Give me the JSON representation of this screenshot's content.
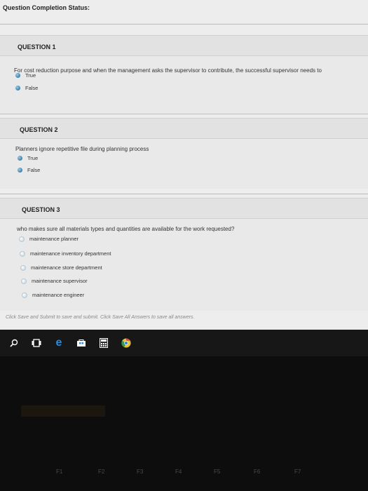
{
  "page": {
    "completion_status_label": "Question Completion Status:"
  },
  "questions": [
    {
      "title": "QUESTION 1",
      "text": "For cost reduction purpose and when the management asks the supervisor to contribute, the successful supervisor needs to",
      "options": [
        "True",
        "False"
      ]
    },
    {
      "title": "QUESTION 2",
      "text": "Planners ignore repetitive file during planning process",
      "options": [
        "True",
        "False"
      ]
    },
    {
      "title": "QUESTION 3",
      "text": "who makes sure all materials types and quantities are available for the work requested?",
      "options": [
        "maintenance planner",
        "maintenance inventory department",
        "maintenance store department",
        "maintenance supervisor",
        "maintenance engineer"
      ]
    }
  ],
  "footer_note": "Click Save and Submit to save and submit. Click Save All Answers to save all answers.",
  "taskbar": {
    "icons": [
      "search-icon",
      "task-view-icon",
      "edge-icon",
      "store-icon",
      "calculator-icon",
      "chrome-icon"
    ]
  },
  "keyboard": {
    "fkeys": [
      "F1",
      "F2",
      "F3",
      "F4",
      "F5",
      "F6",
      "F7"
    ]
  }
}
